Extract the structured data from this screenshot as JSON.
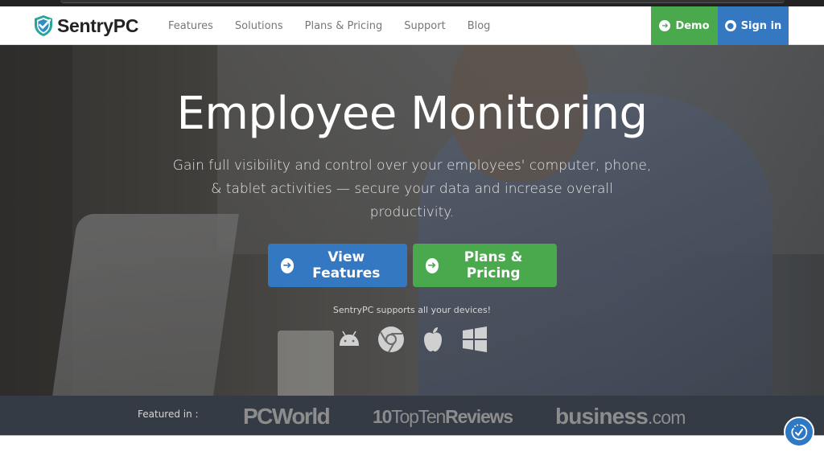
{
  "brand": {
    "name": "SentryPC",
    "shield_color": "#26a69a",
    "check_color": "#2f78c4"
  },
  "nav": {
    "items": [
      {
        "label": "Features"
      },
      {
        "label": "Solutions"
      },
      {
        "label": "Plans & Pricing"
      },
      {
        "label": "Support"
      },
      {
        "label": "Blog"
      }
    ],
    "demo_label": "Demo",
    "signin_label": "Sign in"
  },
  "hero": {
    "title": "Employee Monitoring",
    "subtitle": "Gain full visibility and control over your employees' computer, phone, & tablet activities — secure your data and increase overall productivity.",
    "cta_features": "View Features",
    "cta_pricing": "Plans & Pricing",
    "supports_text": "SentryPC supports all your devices!",
    "devices": [
      "android-icon",
      "chrome-icon",
      "apple-icon",
      "windows-icon"
    ]
  },
  "featured": {
    "label": "Featured in :",
    "logos": {
      "pcworld": "PCWorld",
      "topten_prefix": "10",
      "topten_a": "TopTen",
      "topten_b": "Reviews",
      "biz_a": "business",
      "biz_b": ".com"
    }
  },
  "colors": {
    "green": "#4aa84d",
    "blue": "#3478c2",
    "featured_bg": "#343b45"
  }
}
